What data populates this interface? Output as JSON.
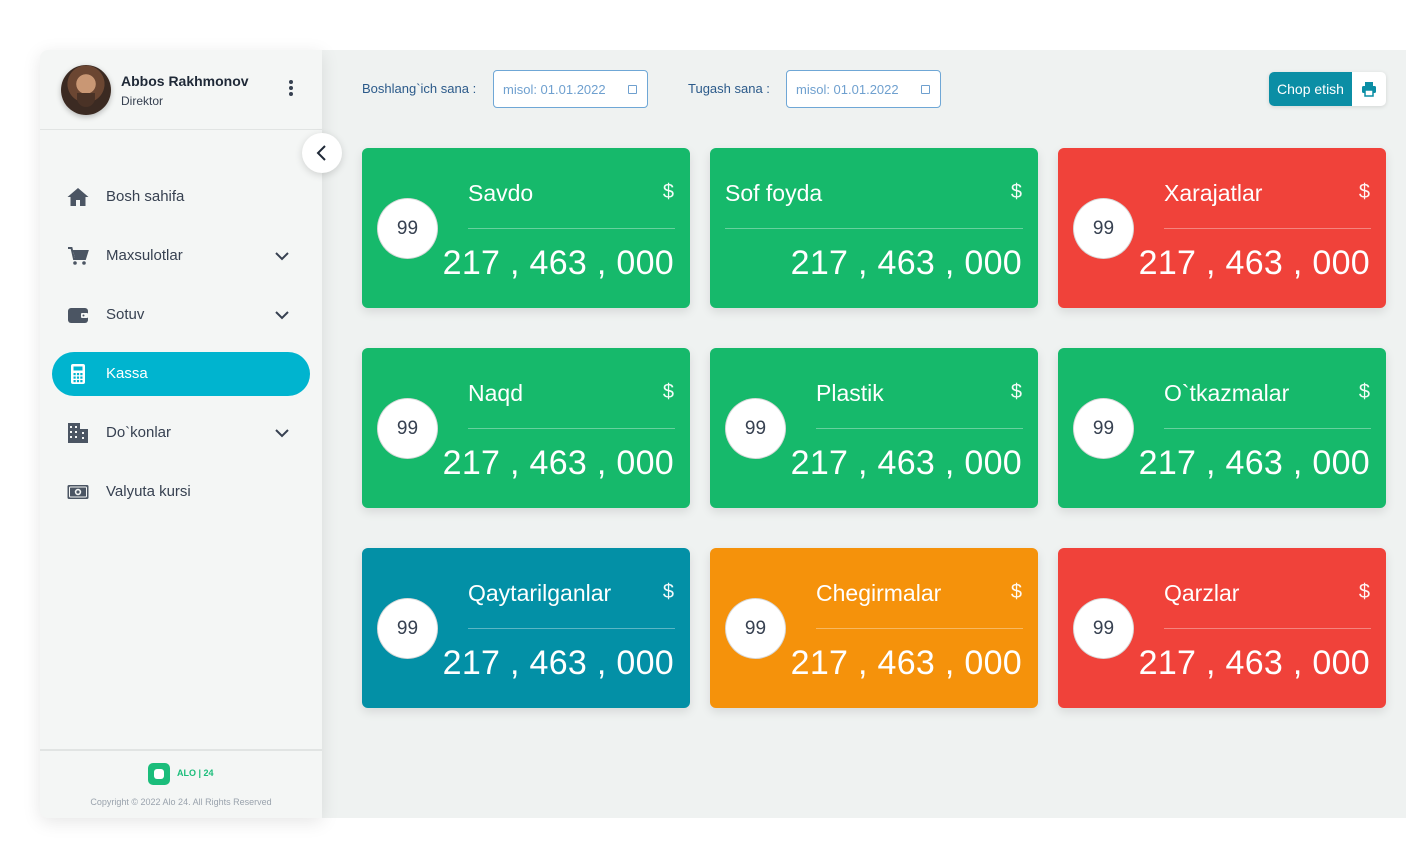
{
  "user": {
    "name": "Abbos Rakhmonov",
    "role": "Direktor"
  },
  "sidebar": {
    "items": [
      {
        "label": "Bosh sahifa",
        "icon": "home-icon",
        "has_submenu": false,
        "active": false
      },
      {
        "label": "Maxsulotlar",
        "icon": "cart-icon",
        "has_submenu": true,
        "active": false
      },
      {
        "label": "Sotuv",
        "icon": "wallet-icon",
        "has_submenu": true,
        "active": false
      },
      {
        "label": "Kassa",
        "icon": "calculator-icon",
        "has_submenu": false,
        "active": true
      },
      {
        "label": "Do`konlar",
        "icon": "building-icon",
        "has_submenu": true,
        "active": false
      },
      {
        "label": "Valyuta kursi",
        "icon": "money-icon",
        "has_submenu": false,
        "active": false
      }
    ],
    "footer": {
      "logo_text": "ALO | 24",
      "copyright": "Copyright © 2022 Alo 24. All Rights Reserved"
    }
  },
  "filters": {
    "start_label": "Boshlang`ich sana :",
    "start_placeholder": "misol: 01.01.2022",
    "end_label": "Tugash sana :",
    "end_placeholder": "misol: 01.01.2022"
  },
  "actions": {
    "print_label": "Chop etish"
  },
  "cards": [
    {
      "title": "Savdo",
      "badge": "99",
      "currency": "$",
      "value": "217 , 463 , 000",
      "color": "#16b96b",
      "show_badge": true
    },
    {
      "title": "Sof foyda",
      "badge": "",
      "currency": "$",
      "value": "217 , 463 , 000",
      "color": "#16b96b",
      "show_badge": false
    },
    {
      "title": "Xarajatlar",
      "badge": "99",
      "currency": "$",
      "value": "217 , 463 , 000",
      "color": "#f0423a",
      "show_badge": true
    },
    {
      "title": "Naqd",
      "badge": "99",
      "currency": "$",
      "value": "217 , 463 , 000",
      "color": "#16b96b",
      "show_badge": true
    },
    {
      "title": "Plastik",
      "badge": "99",
      "currency": "$",
      "value": "217 , 463 , 000",
      "color": "#16b96b",
      "show_badge": true
    },
    {
      "title": "O`tkazmalar",
      "badge": "99",
      "currency": "$",
      "value": "217 , 463 , 000",
      "color": "#16b96b",
      "show_badge": true
    },
    {
      "title": "Qaytarilganlar",
      "badge": "99",
      "currency": "$",
      "value": "217 , 463 , 000",
      "color": "#0390a6",
      "show_badge": true
    },
    {
      "title": "Chegirmalar",
      "badge": "99",
      "currency": "$",
      "value": "217 , 463 , 000",
      "color": "#f5920b",
      "show_badge": true
    },
    {
      "title": "Qarzlar",
      "badge": "99",
      "currency": "$",
      "value": "217 , 463 , 000",
      "color": "#f0423a",
      "show_badge": true
    }
  ],
  "colors": {
    "accent": "#00b4cf",
    "print": "#0b8ea5",
    "green": "#16b96b",
    "red": "#f0423a",
    "teal": "#0390a6",
    "orange": "#f5920b"
  }
}
